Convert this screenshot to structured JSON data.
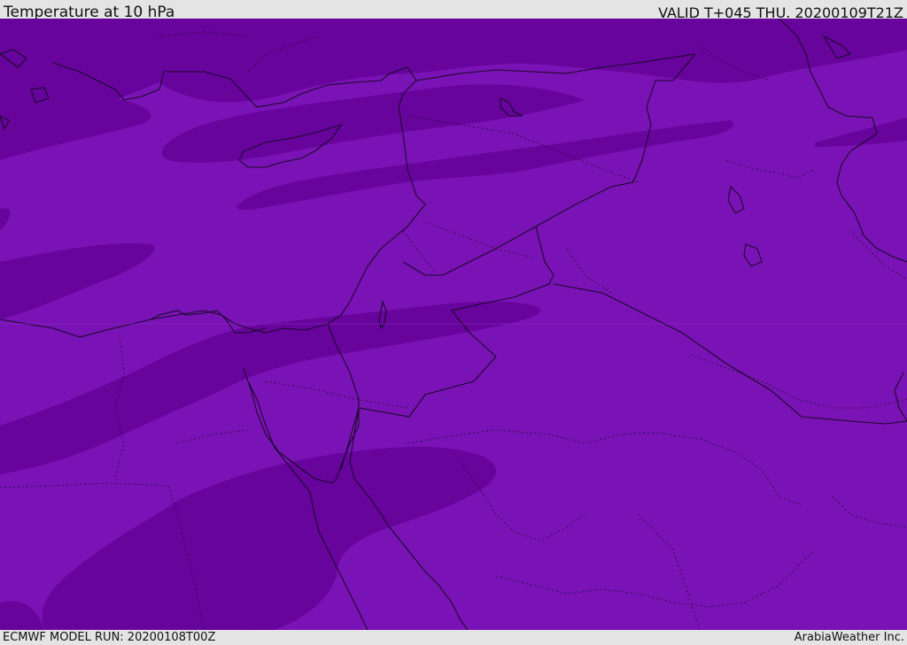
{
  "header": {
    "title": "Temperature at 10 hPa",
    "valid": "VALID T+045 THU. 20200109T21Z"
  },
  "footer": {
    "model_run": "ECMWF MODEL RUN: 20200108T00Z",
    "credit": "ArabiaWeather Inc."
  },
  "map": {
    "colors": {
      "base_shade": "#7a13b5",
      "dark_shade": "#67049c",
      "outline": "#1a0a2a"
    }
  }
}
